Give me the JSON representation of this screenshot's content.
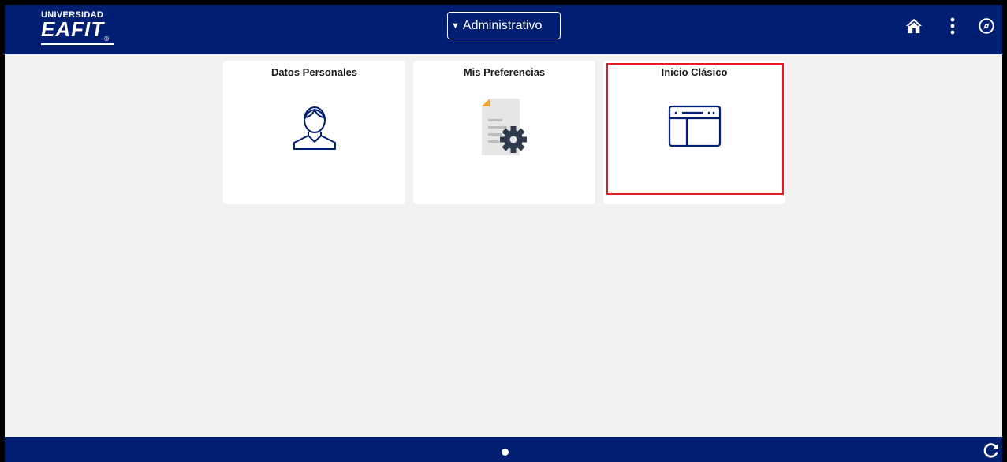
{
  "header": {
    "logo_top": "UNIVERSIDAD",
    "logo_main": "EAFIT",
    "logo_mark": "®",
    "nav_select_label": "Administrativo",
    "home_icon": "home-icon",
    "menu_icon": "more-vertical-icon",
    "navbar_icon": "compass-icon"
  },
  "tiles": [
    {
      "title": "Datos Personales",
      "icon": "person-icon"
    },
    {
      "title": "Mis Preferencias",
      "icon": "document-gear-icon"
    },
    {
      "title": "Inicio Clásico",
      "icon": "classic-window-icon"
    }
  ],
  "footer": {
    "page_indicator": "page-dot-icon",
    "refresh_icon": "refresh-icon"
  },
  "colors": {
    "brand": "#001e72",
    "background": "#f2f2f2",
    "highlight": "#e31b23"
  }
}
